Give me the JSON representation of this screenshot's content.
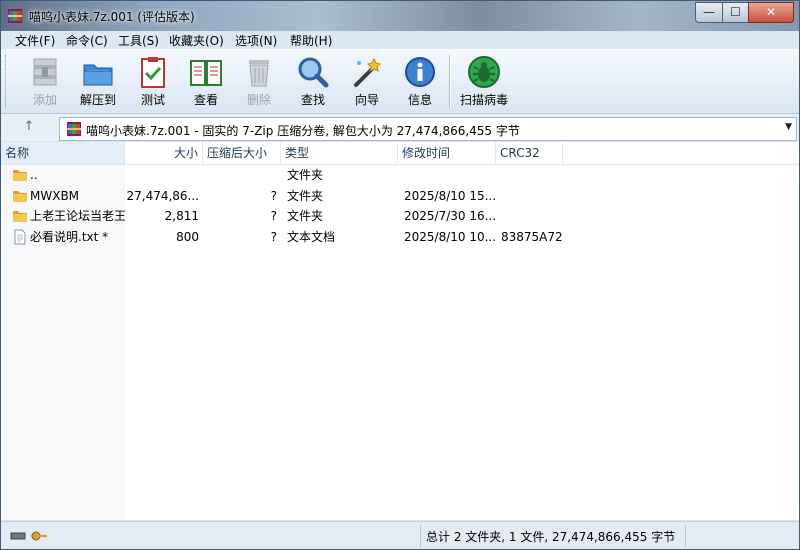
{
  "window": {
    "title": "喵呜小表妹.7z.001 (评估版本)",
    "controls": {
      "minimize": "—",
      "maximize": "☐",
      "close": "✕"
    }
  },
  "menu": {
    "items": [
      "文件(F)",
      "命令(C)",
      "工具(S)",
      "收藏夹(O)",
      "选项(N)",
      "帮助(H)"
    ]
  },
  "toolbar": {
    "items": [
      {
        "label": "添加",
        "icon": "add-archive-icon",
        "enabled": false
      },
      {
        "label": "解压到",
        "icon": "extract-to-icon",
        "enabled": true
      },
      {
        "label": "测试",
        "icon": "test-archive-icon",
        "enabled": true
      },
      {
        "label": "查看",
        "icon": "view-book-icon",
        "enabled": true
      },
      {
        "label": "删除",
        "icon": "delete-trash-icon",
        "enabled": false
      },
      {
        "label": "查找",
        "icon": "find-magnifier-icon",
        "enabled": true
      },
      {
        "label": "向导",
        "icon": "wizard-wand-icon",
        "enabled": true
      },
      {
        "label": "信息",
        "icon": "info-icon",
        "enabled": true
      },
      {
        "label": "扫描病毒",
        "icon": "virus-scan-icon",
        "enabled": true
      }
    ]
  },
  "address": {
    "up_icon": "↑",
    "path": "喵呜小表妹.7z.001 - 固实的 7-Zip 压缩分卷, 解包大小为 27,474,866,455 字节",
    "dropdown_icon": "▼"
  },
  "columns": [
    "名称",
    "大小",
    "压缩后大小",
    "类型",
    "修改时间",
    "CRC32"
  ],
  "files": [
    {
      "name": "..",
      "size": "",
      "packed": "",
      "type": "文件夹",
      "modified": "",
      "crc": "",
      "kind": "folder"
    },
    {
      "name": "MWXBM",
      "size": "27,474,86...",
      "packed": "?",
      "type": "文件夹",
      "modified": "2025/8/10 15...",
      "crc": "",
      "kind": "folder"
    },
    {
      "name": "上老王论坛当老王",
      "size": "2,811",
      "packed": "?",
      "type": "文件夹",
      "modified": "2025/7/30 16...",
      "crc": "",
      "kind": "folder"
    },
    {
      "name": "必看说明.txt *",
      "size": "800",
      "packed": "?",
      "type": "文本文档",
      "modified": "2025/8/10 10...",
      "crc": "83875A72",
      "kind": "text"
    }
  ],
  "status": {
    "summary": "总计 2 文件夹, 1 文件, 27,474,866,455 字节"
  },
  "colors": {
    "accent": "#1e395b",
    "folder": "#e8b73a",
    "close": "#c7513d"
  }
}
